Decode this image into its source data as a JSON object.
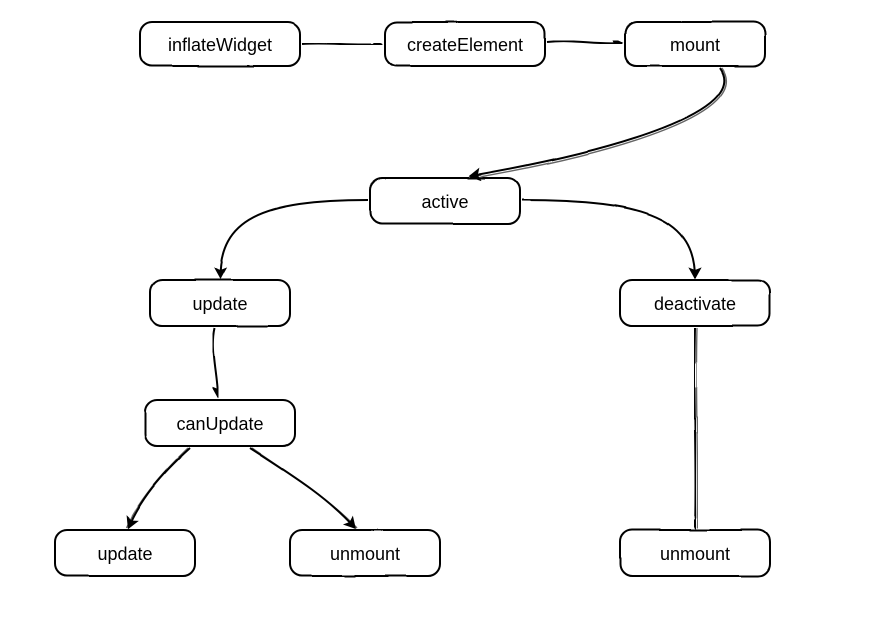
{
  "diagram": {
    "nodes": {
      "inflateWidget": {
        "label": "inflateWidget"
      },
      "createElement": {
        "label": "createElement"
      },
      "mount": {
        "label": "mount"
      },
      "active": {
        "label": "active"
      },
      "update1": {
        "label": "update"
      },
      "deactivate": {
        "label": "deactivate"
      },
      "canUpdate": {
        "label": "canUpdate"
      },
      "update2": {
        "label": "update"
      },
      "unmount1": {
        "label": "unmount"
      },
      "unmount2": {
        "label": "unmount"
      }
    },
    "edges": [
      {
        "from": "inflateWidget",
        "to": "createElement"
      },
      {
        "from": "createElement",
        "to": "mount"
      },
      {
        "from": "mount",
        "to": "active"
      },
      {
        "from": "active",
        "to": "update1"
      },
      {
        "from": "active",
        "to": "deactivate"
      },
      {
        "from": "update1",
        "to": "canUpdate"
      },
      {
        "from": "canUpdate",
        "to": "update2"
      },
      {
        "from": "canUpdate",
        "to": "unmount1"
      },
      {
        "from": "deactivate",
        "to": "unmount2"
      }
    ]
  }
}
